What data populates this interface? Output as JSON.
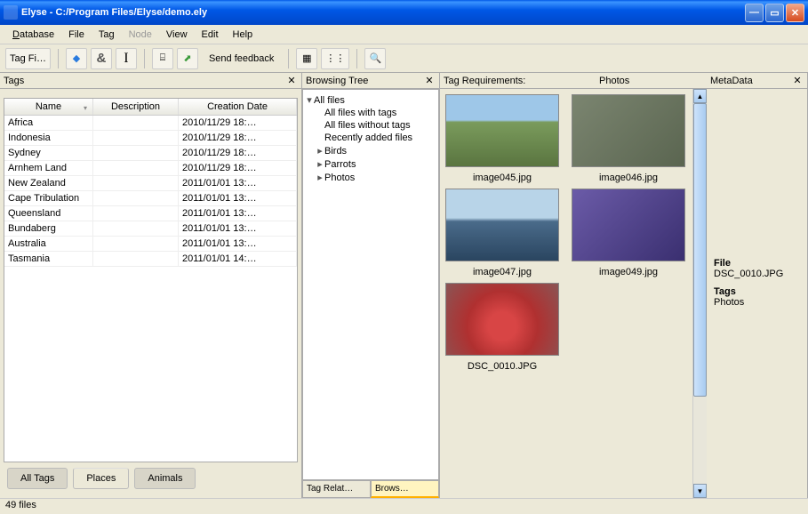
{
  "window": {
    "title": "Elyse - C:/Program Files/Elyse/demo.ely"
  },
  "menu": {
    "database": "Database",
    "file": "File",
    "tag": "Tag",
    "node": "Node",
    "view": "View",
    "edit": "Edit",
    "help": "Help"
  },
  "toolbar": {
    "tag_filter": "Tag Fi…",
    "send_feedback": "Send feedback"
  },
  "tags_panel": {
    "title": "Tags",
    "columns": {
      "name": "Name",
      "description": "Description",
      "date": "Creation Date"
    },
    "rows": [
      {
        "name": "Africa",
        "desc": "",
        "date": "2010/11/29 18:…"
      },
      {
        "name": "Indonesia",
        "desc": "",
        "date": "2010/11/29 18:…"
      },
      {
        "name": "Sydney",
        "desc": "",
        "date": "2010/11/29 18:…"
      },
      {
        "name": "Arnhem Land",
        "desc": "",
        "date": "2010/11/29 18:…"
      },
      {
        "name": "New Zealand",
        "desc": "",
        "date": "2011/01/01 13:…"
      },
      {
        "name": "Cape Tribulation",
        "desc": "",
        "date": "2011/01/01 13:…"
      },
      {
        "name": "Queensland",
        "desc": "",
        "date": "2011/01/01 13:…"
      },
      {
        "name": "Bundaberg",
        "desc": "",
        "date": "2011/01/01 13:…"
      },
      {
        "name": "Australia",
        "desc": "",
        "date": "2011/01/01 13:…"
      },
      {
        "name": "Tasmania",
        "desc": "",
        "date": "2011/01/01 14:…"
      }
    ],
    "tabs": {
      "all": "All Tags",
      "places": "Places",
      "animals": "Animals"
    }
  },
  "tree_panel": {
    "title": "Browsing Tree",
    "root": "All files",
    "items": [
      "All files with tags",
      "All files without tags",
      "Recently added files",
      "Birds",
      "Parrots",
      "Photos"
    ],
    "bottom_tabs": {
      "relations": "Tag Relat…",
      "browse": "Brows…"
    }
  },
  "photos_panel": {
    "requirements_label": "Tag Requirements:",
    "title": "Photos",
    "thumbs": [
      {
        "caption": "image045.jpg"
      },
      {
        "caption": "image046.jpg"
      },
      {
        "caption": "image047.jpg"
      },
      {
        "caption": "image049.jpg"
      },
      {
        "caption": "DSC_0010.JPG"
      }
    ]
  },
  "meta_panel": {
    "title": "MetaData",
    "file_label": "File",
    "file_value": "DSC_0010.JPG",
    "tags_label": "Tags",
    "tags_value": "Photos"
  },
  "status": {
    "text": "49 files"
  }
}
